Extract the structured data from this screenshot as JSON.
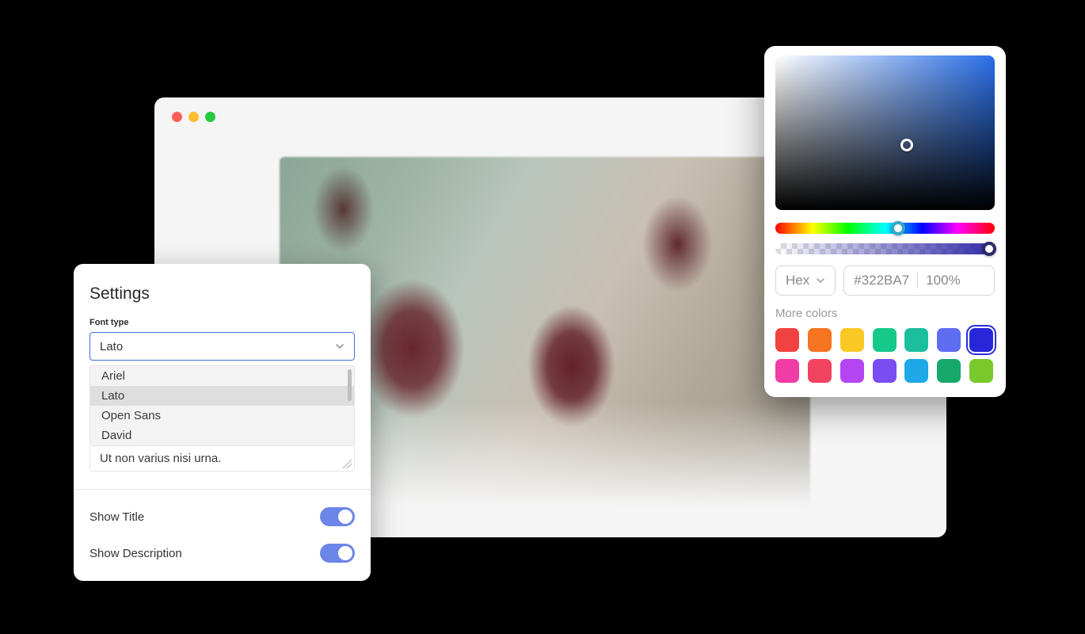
{
  "settings": {
    "title": "Settings",
    "font_type_label": "Font type",
    "font_selected": "Lato",
    "font_options": [
      "Ariel",
      "Lato",
      "Open Sans",
      "David"
    ],
    "description_text": "Ut non varius nisi urna.",
    "show_title_label": "Show Title",
    "show_title_on": true,
    "show_description_label": "Show Description",
    "show_description_on": true
  },
  "color_picker": {
    "format_label": "Hex",
    "hex_value": "#322BA7",
    "opacity_value": "100%",
    "more_colors_label": "More colors",
    "swatches_row1": [
      "#f24343",
      "#f77421",
      "#f9c825",
      "#16c98a",
      "#1bbfa0",
      "#5f6ef0",
      "#2727d9"
    ],
    "swatches_row2": [
      "#f23ca6",
      "#f24360",
      "#b544f2",
      "#7a4df2",
      "#1fa8e8",
      "#17a96b",
      "#7ac92c"
    ],
    "selected_swatch_index": 6
  }
}
